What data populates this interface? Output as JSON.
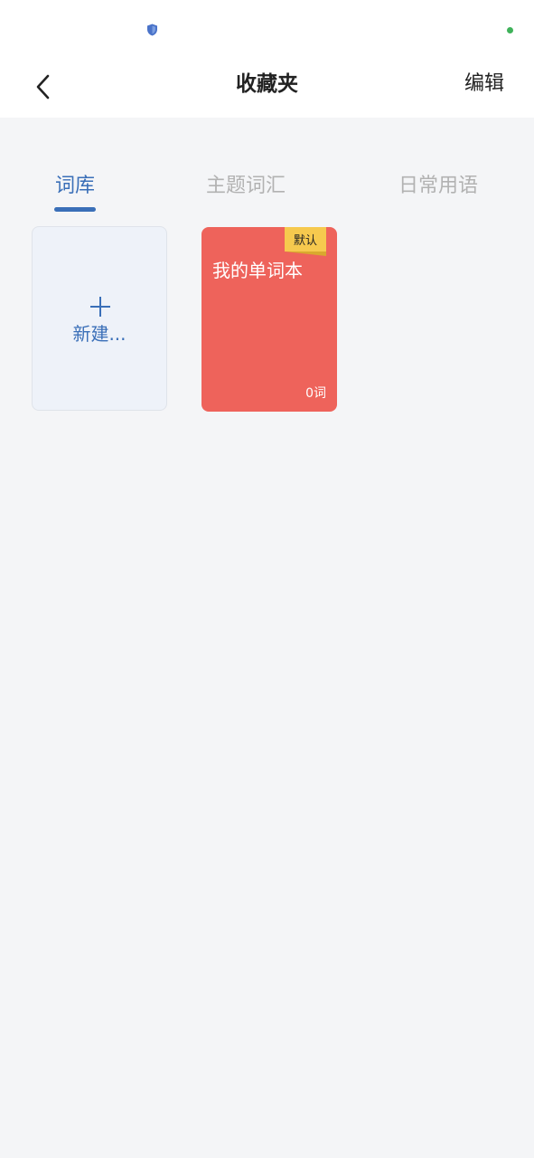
{
  "status_bar": {
    "shield_icon": "shield-icon",
    "dot_color": "#3fb25a"
  },
  "header": {
    "back_icon": "chevron-left-icon",
    "title": "收藏夹",
    "edit_label": "编辑"
  },
  "tabs": [
    {
      "label": "词库",
      "active": true
    },
    {
      "label": "主题词汇",
      "active": false
    },
    {
      "label": "日常用语",
      "active": false
    }
  ],
  "new_card": {
    "icon": "plus-icon",
    "label": "新建..."
  },
  "wordbooks": [
    {
      "title": "我的单词本",
      "badge": "默认",
      "count": "0词",
      "color": "#ee635b"
    }
  ],
  "colors": {
    "accent": "#3a6fb8",
    "background": "#f4f5f7",
    "badge": "#f6c94e"
  }
}
